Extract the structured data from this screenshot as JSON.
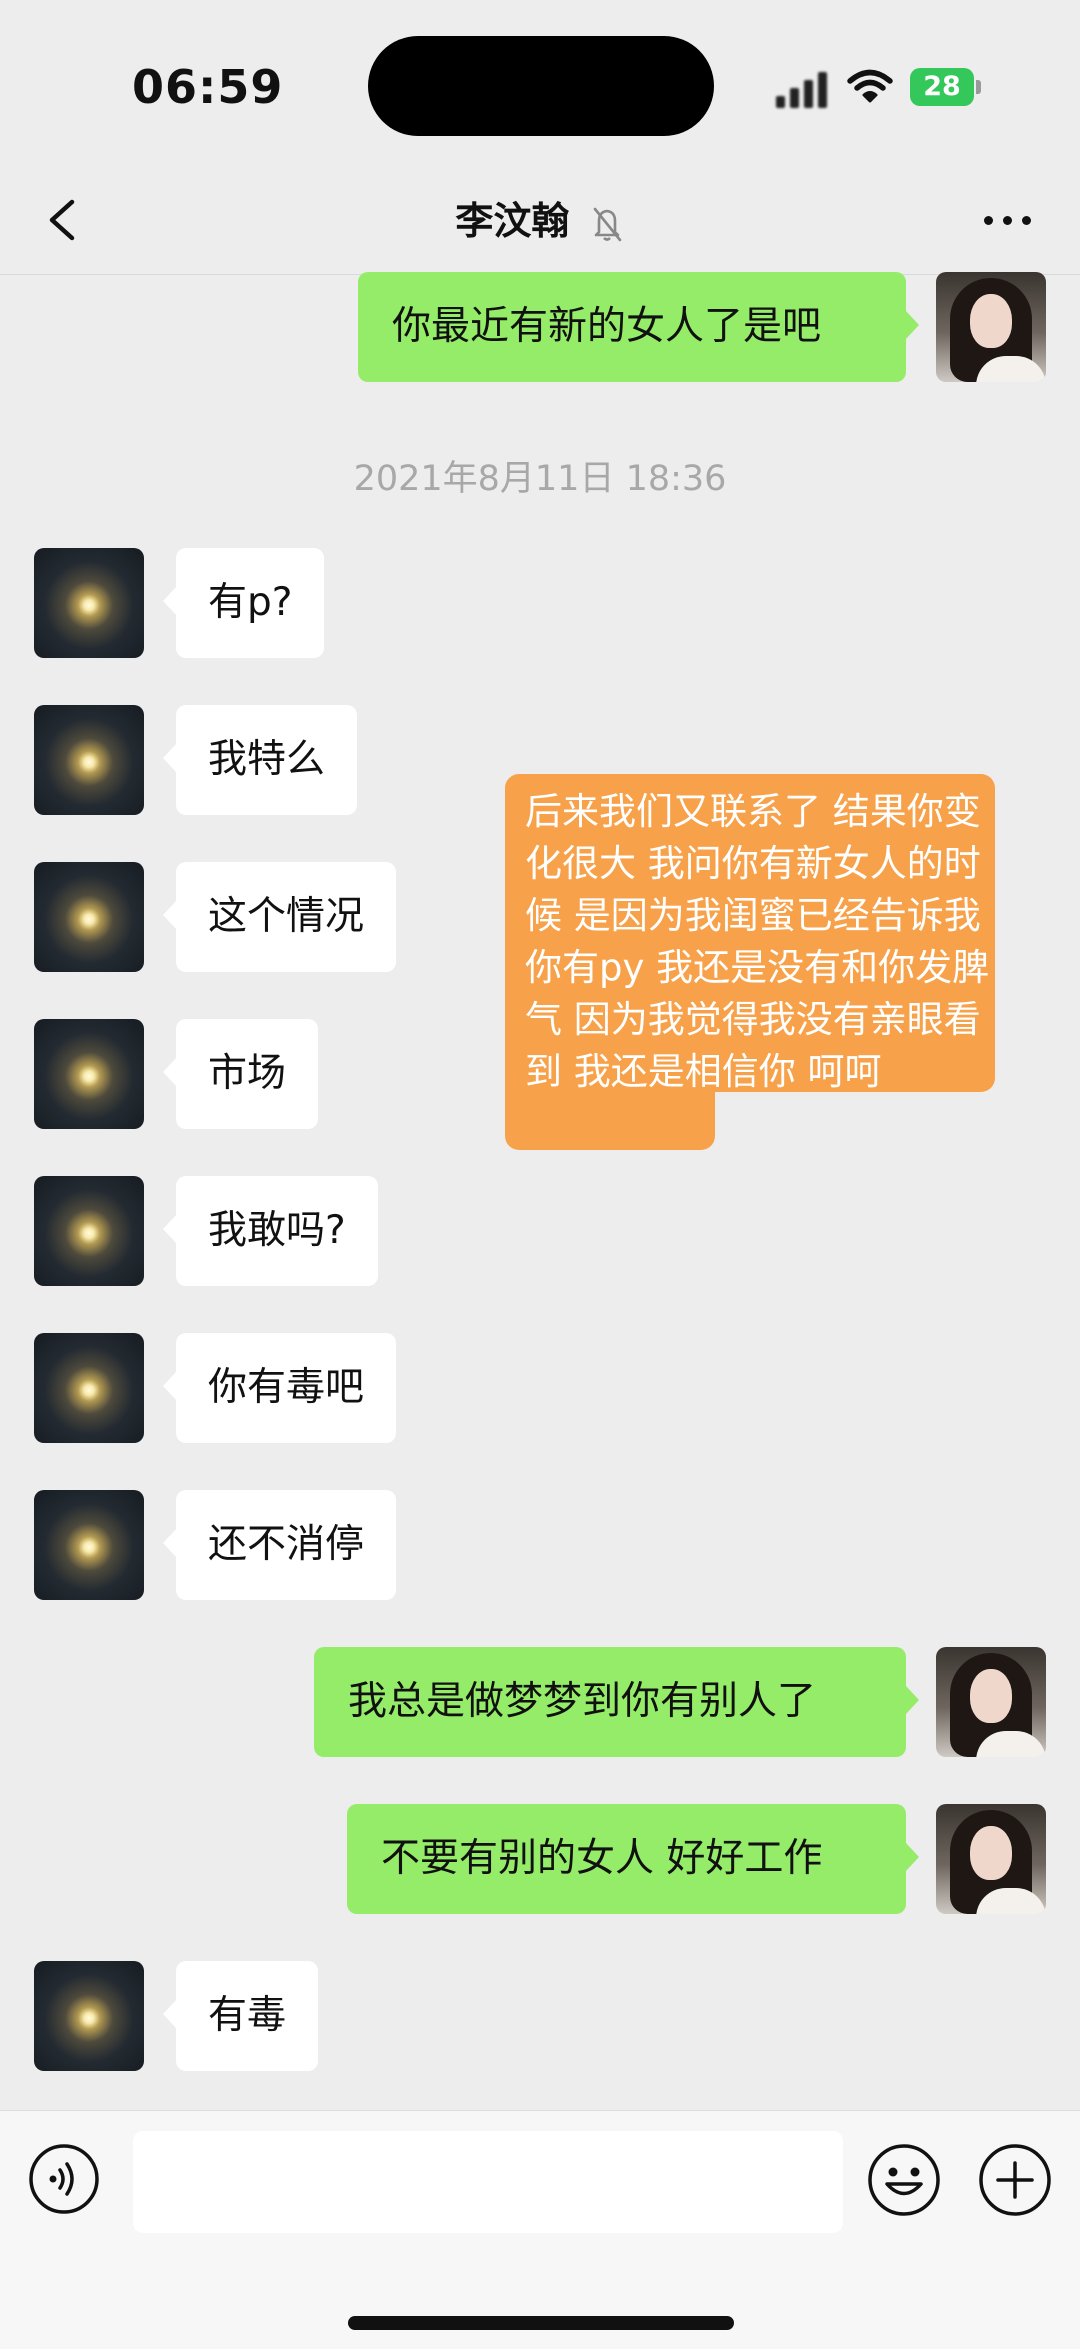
{
  "status_bar": {
    "time": "06:59",
    "battery": "28",
    "icons": [
      "signal-icon",
      "wifi-icon",
      "battery-icon"
    ]
  },
  "nav": {
    "title": "李汶翰",
    "icons": [
      "back-icon",
      "mute-bell-icon",
      "more-icon"
    ]
  },
  "messages": [
    {
      "side": "right",
      "text": "你最近有新的女人了是吧"
    },
    {
      "type": "timestamp",
      "text": "2021年8月11日 18:36"
    },
    {
      "side": "left",
      "text": "有p?"
    },
    {
      "side": "left",
      "text": "我特么"
    },
    {
      "side": "left",
      "text": "这个情况"
    },
    {
      "side": "left",
      "text": "市场"
    },
    {
      "side": "left",
      "text": "我敢吗?"
    },
    {
      "side": "left",
      "text": "你有毒吧"
    },
    {
      "side": "left",
      "text": "还不消停"
    },
    {
      "side": "right",
      "text": "我总是做梦梦到你有别人了"
    },
    {
      "side": "right",
      "text": "不要有别的女人 好好工作"
    },
    {
      "side": "left",
      "text": "有毒"
    }
  ],
  "annotation": {
    "text": "后来我们又联系了 结果你变化很大 我问你有新女人的时候 是因为我闺蜜已经告诉我你有py 我还是没有和你发脾气 因为我觉得我没有亲眼看到 我还是相信你 呵呵",
    "color": "#f7a24a"
  },
  "input_bar": {
    "placeholder": "",
    "icons": [
      "voice-icon",
      "emoji-icon",
      "plus-icon"
    ]
  },
  "colors": {
    "background": "#ededed",
    "sent_bubble": "#95ec69",
    "received_bubble": "#ffffff",
    "timestamp": "#a8a8a8",
    "battery": "#34c759"
  }
}
